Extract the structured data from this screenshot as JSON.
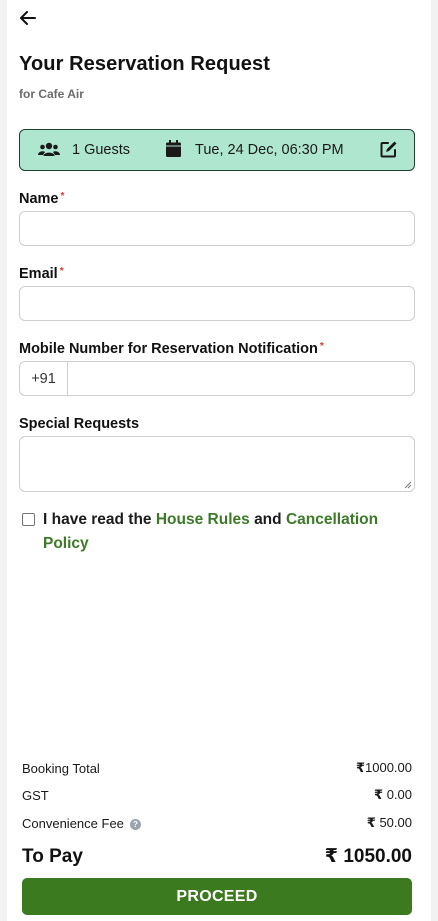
{
  "header": {
    "title": "Your Reservation Request",
    "subtitle": "for Cafe Air"
  },
  "summary": {
    "guests": "1 Guests",
    "datetime": "Tue, 24 Dec, 06:30 PM",
    "background": "#aee6cf"
  },
  "form": {
    "name_label": "Name",
    "email_label": "Email",
    "mobile_label": "Mobile Number for Reservation Notification",
    "country_code": "+91",
    "special_label": "Special Requests",
    "required_mark": "*",
    "name_value": "",
    "email_value": "",
    "mobile_value": "",
    "special_value": ""
  },
  "consent": {
    "prefix": "I have read the",
    "house_rules": "House Rules",
    "and": "and",
    "cancellation": "Cancellation Policy",
    "checked": false
  },
  "pricing": {
    "booking_total_label": "Booking Total",
    "booking_total_value": "1000.00",
    "gst_label": "GST",
    "gst_value": "0.00",
    "fee_label": "Convenience Fee",
    "fee_value": "50.00",
    "topay_label": "To Pay",
    "topay_value": "1050.00",
    "currency": "₹"
  },
  "actions": {
    "proceed": "PROCEED",
    "accent": "#3b7a1f",
    "link_color": "#3c7a28"
  }
}
